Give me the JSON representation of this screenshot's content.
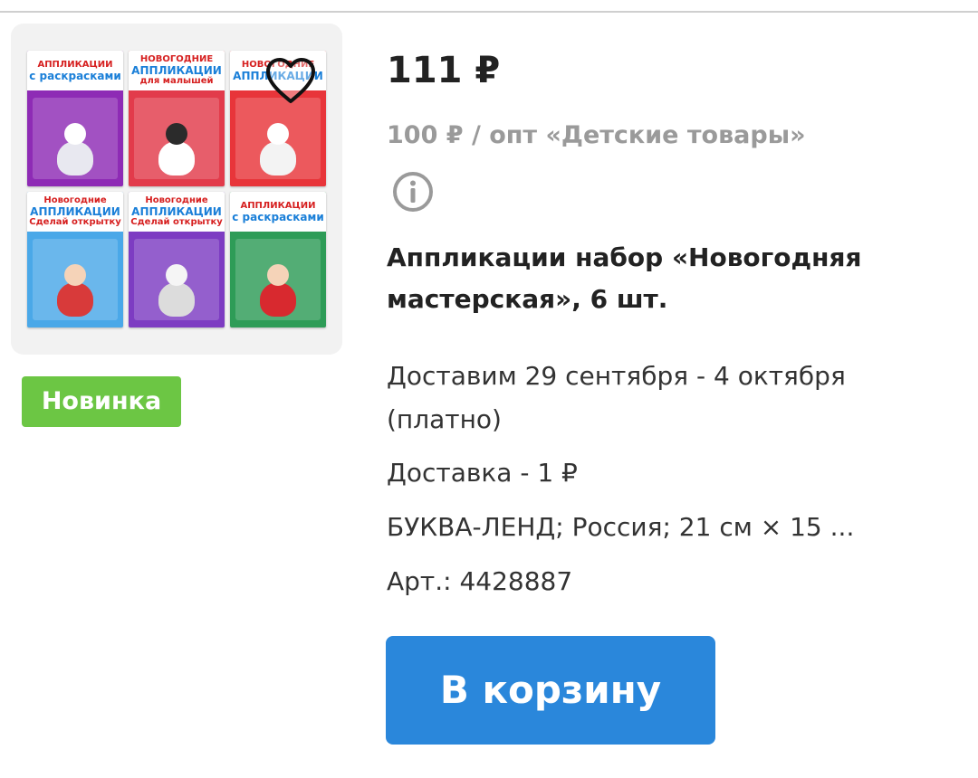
{
  "product": {
    "price": "111 ₽",
    "wholesale_price": "100 ₽ / опт «Детские товары»",
    "title": "Аппликации набор «Новогодняя мастерская», 6 шт.",
    "badge": "Новинка",
    "delivery_date": "Доставим 29 сентября - 4 октября (платно)",
    "delivery_cost": "Доставка - 1 ₽",
    "specs": "БУКВА-ЛЕНД; Россия; 21 см × 15 ...",
    "article": "Арт.: 4428887",
    "cart_button_label": "В корзину"
  },
  "icons": {
    "wishlist": "heart-outline-icon",
    "info": "info-circle-icon"
  },
  "product_image": {
    "books": [
      {
        "lines": [
          "АППЛИКАЦИИ",
          "с раскрасками"
        ],
        "color": "#8e2bb5",
        "figure_head": "#ffffff",
        "figure_body": "#e8e8f0"
      },
      {
        "lines": [
          "НОВОГОДНИЕ",
          "АППЛИКАЦИИ",
          "для малышей"
        ],
        "color": "#e23b4b",
        "figure_head": "#2b2b2b",
        "figure_body": "#ffffff"
      },
      {
        "lines": [
          "НОВОГОДНИЕ",
          "АППЛИКАЦИИ"
        ],
        "color": "#e8353a",
        "figure_head": "#ffffff",
        "figure_body": "#f3f3f3"
      },
      {
        "lines": [
          "Новогодние",
          "АППЛИКАЦИИ",
          "Сделай открытку"
        ],
        "color": "#4aa8e8",
        "figure_head": "#f5d3b8",
        "figure_body": "#d83a3a"
      },
      {
        "lines": [
          "Новогодние",
          "АППЛИКАЦИИ",
          "Сделай открытку"
        ],
        "color": "#7d3cc2",
        "figure_head": "#f5f5f5",
        "figure_body": "#dcdcdc"
      },
      {
        "lines": [
          "АППЛИКАЦИИ",
          "с раскрасками"
        ],
        "color": "#2e9c57",
        "figure_head": "#f5d3b8",
        "figure_body": "#d8292f"
      }
    ]
  },
  "colors": {
    "accent_button": "#2a87db",
    "badge_green": "#6cc644",
    "muted_text": "#9a9a9a"
  }
}
